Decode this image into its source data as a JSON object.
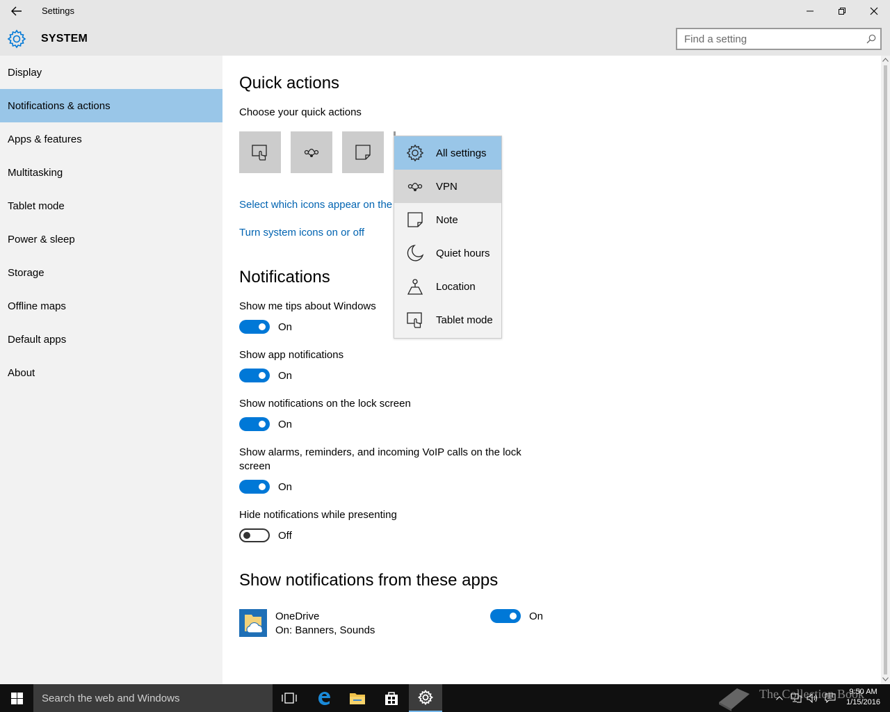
{
  "window": {
    "title": "Settings"
  },
  "header": {
    "section": "SYSTEM",
    "search_placeholder": "Find a setting"
  },
  "sidebar": {
    "items": [
      {
        "label": "Display"
      },
      {
        "label": "Notifications & actions",
        "active": true
      },
      {
        "label": "Apps & features"
      },
      {
        "label": "Multitasking"
      },
      {
        "label": "Tablet mode"
      },
      {
        "label": "Power & sleep"
      },
      {
        "label": "Storage"
      },
      {
        "label": "Offline maps"
      },
      {
        "label": "Default apps"
      },
      {
        "label": "About"
      }
    ]
  },
  "quick_actions": {
    "heading": "Quick actions",
    "subheading": "Choose your quick actions",
    "tiles": [
      "tablet-mode-icon",
      "vpn-icon",
      "note-icon"
    ],
    "link_icons": "Select which icons appear on the",
    "link_system": "Turn system icons on or off"
  },
  "dropdown": {
    "items": [
      {
        "label": "All settings",
        "icon": "gear-icon",
        "state": "selected"
      },
      {
        "label": "VPN",
        "icon": "vpn-icon",
        "state": "hover"
      },
      {
        "label": "Note",
        "icon": "note-icon"
      },
      {
        "label": "Quiet hours",
        "icon": "moon-icon"
      },
      {
        "label": "Location",
        "icon": "location-icon"
      },
      {
        "label": "Tablet mode",
        "icon": "tablet-mode-icon"
      }
    ]
  },
  "notifications": {
    "heading": "Notifications",
    "settings": [
      {
        "label": "Show me tips about Windows",
        "state": "On"
      },
      {
        "label": "Show app notifications",
        "state": "On"
      },
      {
        "label": "Show notifications on the lock screen",
        "state": "On"
      },
      {
        "label_line1": "Show alarms, reminders, and incoming VoIP calls on the lock",
        "label_line2": "screen",
        "state": "On"
      },
      {
        "label": "Hide notifications while presenting",
        "state": "Off"
      }
    ]
  },
  "apps": {
    "heading": "Show notifications from these apps",
    "items": [
      {
        "name": "OneDrive",
        "detail": "On: Banners, Sounds",
        "state": "On"
      }
    ]
  },
  "taskbar": {
    "search_placeholder": "Search the web and Windows",
    "time": "9:50 AM",
    "date": "1/15/2016",
    "watermark": "The Collection Book"
  },
  "colors": {
    "accent": "#0078d7",
    "selection": "#99c6e8",
    "link": "#0063b1"
  }
}
